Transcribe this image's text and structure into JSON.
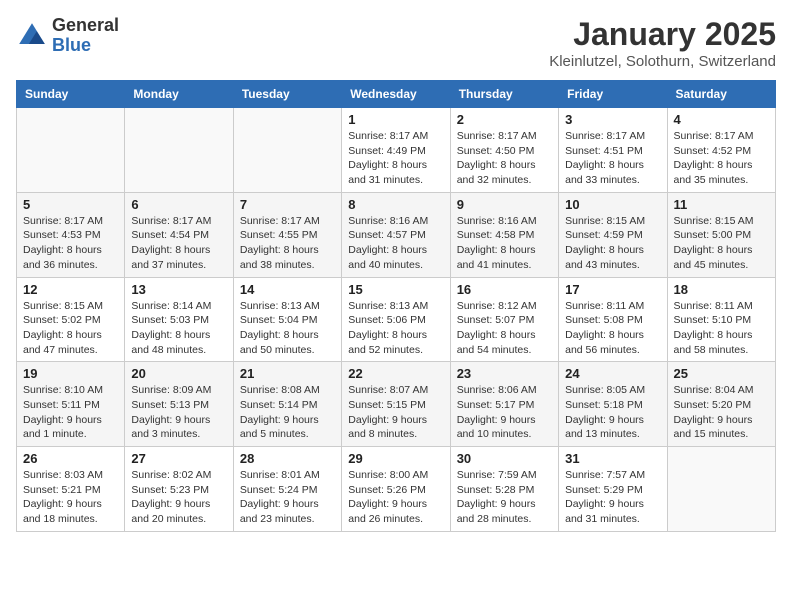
{
  "header": {
    "logo_general": "General",
    "logo_blue": "Blue",
    "month_title": "January 2025",
    "location": "Kleinlutzel, Solothurn, Switzerland"
  },
  "days_of_week": [
    "Sunday",
    "Monday",
    "Tuesday",
    "Wednesday",
    "Thursday",
    "Friday",
    "Saturday"
  ],
  "weeks": [
    [
      {
        "day": "",
        "detail": ""
      },
      {
        "day": "",
        "detail": ""
      },
      {
        "day": "",
        "detail": ""
      },
      {
        "day": "1",
        "detail": "Sunrise: 8:17 AM\nSunset: 4:49 PM\nDaylight: 8 hours\nand 31 minutes."
      },
      {
        "day": "2",
        "detail": "Sunrise: 8:17 AM\nSunset: 4:50 PM\nDaylight: 8 hours\nand 32 minutes."
      },
      {
        "day": "3",
        "detail": "Sunrise: 8:17 AM\nSunset: 4:51 PM\nDaylight: 8 hours\nand 33 minutes."
      },
      {
        "day": "4",
        "detail": "Sunrise: 8:17 AM\nSunset: 4:52 PM\nDaylight: 8 hours\nand 35 minutes."
      }
    ],
    [
      {
        "day": "5",
        "detail": "Sunrise: 8:17 AM\nSunset: 4:53 PM\nDaylight: 8 hours\nand 36 minutes."
      },
      {
        "day": "6",
        "detail": "Sunrise: 8:17 AM\nSunset: 4:54 PM\nDaylight: 8 hours\nand 37 minutes."
      },
      {
        "day": "7",
        "detail": "Sunrise: 8:17 AM\nSunset: 4:55 PM\nDaylight: 8 hours\nand 38 minutes."
      },
      {
        "day": "8",
        "detail": "Sunrise: 8:16 AM\nSunset: 4:57 PM\nDaylight: 8 hours\nand 40 minutes."
      },
      {
        "day": "9",
        "detail": "Sunrise: 8:16 AM\nSunset: 4:58 PM\nDaylight: 8 hours\nand 41 minutes."
      },
      {
        "day": "10",
        "detail": "Sunrise: 8:15 AM\nSunset: 4:59 PM\nDaylight: 8 hours\nand 43 minutes."
      },
      {
        "day": "11",
        "detail": "Sunrise: 8:15 AM\nSunset: 5:00 PM\nDaylight: 8 hours\nand 45 minutes."
      }
    ],
    [
      {
        "day": "12",
        "detail": "Sunrise: 8:15 AM\nSunset: 5:02 PM\nDaylight: 8 hours\nand 47 minutes."
      },
      {
        "day": "13",
        "detail": "Sunrise: 8:14 AM\nSunset: 5:03 PM\nDaylight: 8 hours\nand 48 minutes."
      },
      {
        "day": "14",
        "detail": "Sunrise: 8:13 AM\nSunset: 5:04 PM\nDaylight: 8 hours\nand 50 minutes."
      },
      {
        "day": "15",
        "detail": "Sunrise: 8:13 AM\nSunset: 5:06 PM\nDaylight: 8 hours\nand 52 minutes."
      },
      {
        "day": "16",
        "detail": "Sunrise: 8:12 AM\nSunset: 5:07 PM\nDaylight: 8 hours\nand 54 minutes."
      },
      {
        "day": "17",
        "detail": "Sunrise: 8:11 AM\nSunset: 5:08 PM\nDaylight: 8 hours\nand 56 minutes."
      },
      {
        "day": "18",
        "detail": "Sunrise: 8:11 AM\nSunset: 5:10 PM\nDaylight: 8 hours\nand 58 minutes."
      }
    ],
    [
      {
        "day": "19",
        "detail": "Sunrise: 8:10 AM\nSunset: 5:11 PM\nDaylight: 9 hours\nand 1 minute."
      },
      {
        "day": "20",
        "detail": "Sunrise: 8:09 AM\nSunset: 5:13 PM\nDaylight: 9 hours\nand 3 minutes."
      },
      {
        "day": "21",
        "detail": "Sunrise: 8:08 AM\nSunset: 5:14 PM\nDaylight: 9 hours\nand 5 minutes."
      },
      {
        "day": "22",
        "detail": "Sunrise: 8:07 AM\nSunset: 5:15 PM\nDaylight: 9 hours\nand 8 minutes."
      },
      {
        "day": "23",
        "detail": "Sunrise: 8:06 AM\nSunset: 5:17 PM\nDaylight: 9 hours\nand 10 minutes."
      },
      {
        "day": "24",
        "detail": "Sunrise: 8:05 AM\nSunset: 5:18 PM\nDaylight: 9 hours\nand 13 minutes."
      },
      {
        "day": "25",
        "detail": "Sunrise: 8:04 AM\nSunset: 5:20 PM\nDaylight: 9 hours\nand 15 minutes."
      }
    ],
    [
      {
        "day": "26",
        "detail": "Sunrise: 8:03 AM\nSunset: 5:21 PM\nDaylight: 9 hours\nand 18 minutes."
      },
      {
        "day": "27",
        "detail": "Sunrise: 8:02 AM\nSunset: 5:23 PM\nDaylight: 9 hours\nand 20 minutes."
      },
      {
        "day": "28",
        "detail": "Sunrise: 8:01 AM\nSunset: 5:24 PM\nDaylight: 9 hours\nand 23 minutes."
      },
      {
        "day": "29",
        "detail": "Sunrise: 8:00 AM\nSunset: 5:26 PM\nDaylight: 9 hours\nand 26 minutes."
      },
      {
        "day": "30",
        "detail": "Sunrise: 7:59 AM\nSunset: 5:28 PM\nDaylight: 9 hours\nand 28 minutes."
      },
      {
        "day": "31",
        "detail": "Sunrise: 7:57 AM\nSunset: 5:29 PM\nDaylight: 9 hours\nand 31 minutes."
      },
      {
        "day": "",
        "detail": ""
      }
    ]
  ]
}
